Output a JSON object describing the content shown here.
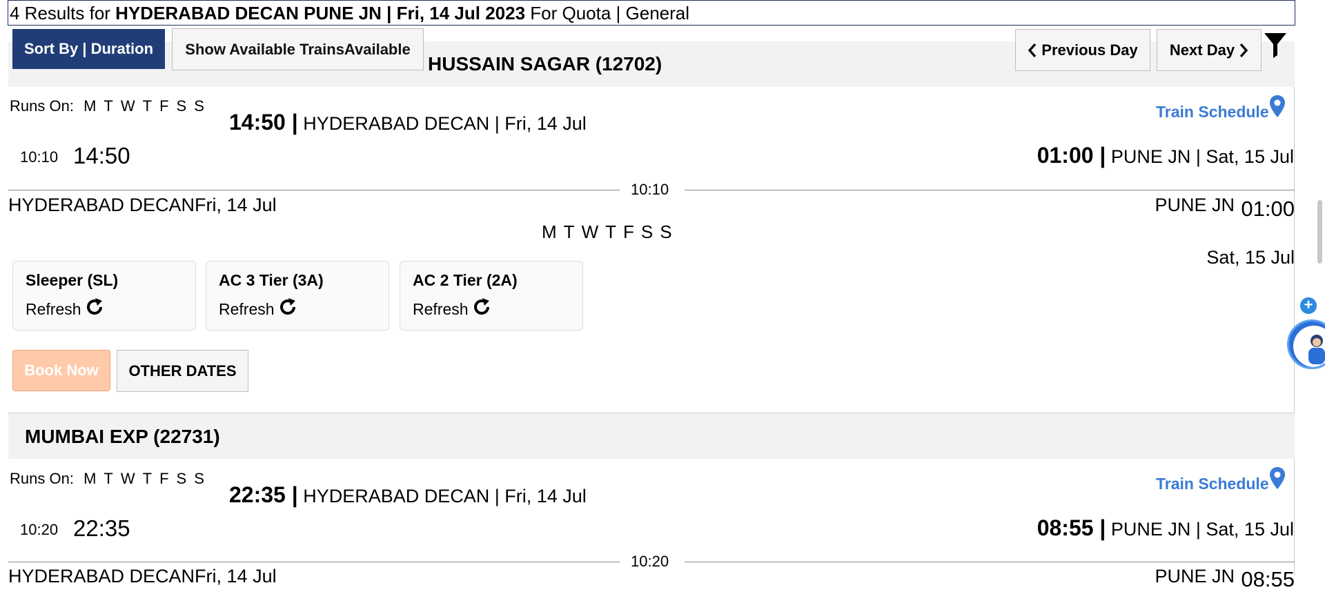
{
  "results": {
    "count_prefix": "4 Results for ",
    "route": "HYDERABAD DECAN PUNE JN | Fri, 14 Jul 2023",
    "quota_text": " For Quota | General"
  },
  "toolbar": {
    "sort_label": "Sort By | Duration",
    "show_available_label": "Show Available TrainsAvailable",
    "prev_day_label": "Previous Day",
    "next_day_label": "Next Day"
  },
  "trains": [
    {
      "name": "HUSSAIN SAGAR (12702)",
      "runs_on_label": "Runs On:",
      "days": [
        "M",
        "T",
        "W",
        "T",
        "F",
        "S",
        "S"
      ],
      "dep_time": "14:50 |",
      "dep_info": " HYDERABAD DECAN | Fri, 14 Jul",
      "duration_small": "10:10",
      "dep_time_big": "14:50",
      "arr_time": "01:00 |",
      "arr_info": " PUNE JN | Sat, 15 Jul",
      "schedule_label": "Train Schedule",
      "mid_duration": "10:10",
      "from_station": "HYDERABAD DECANFri, 14 Jul",
      "to_station": "PUNE JN",
      "arr_time_big": "01:00",
      "arr_date": "Sat, 15 Jul",
      "classes": [
        {
          "name": "Sleeper (SL)",
          "refresh": "Refresh"
        },
        {
          "name": "AC 3 Tier (3A)",
          "refresh": "Refresh"
        },
        {
          "name": "AC 2 Tier (2A)",
          "refresh": "Refresh"
        }
      ],
      "book_label": "Book Now",
      "other_dates_label": "OTHER DATES"
    },
    {
      "name": "MUMBAI EXP (22731)",
      "runs_on_label": "Runs On:",
      "days": [
        "M",
        "T",
        "W",
        "T",
        "F",
        "S",
        "S"
      ],
      "dep_time": "22:35 |",
      "dep_info": " HYDERABAD DECAN | Fri, 14 Jul",
      "duration_small": "10:20",
      "dep_time_big": "22:35",
      "arr_time": "08:55 |",
      "arr_info": " PUNE JN | Sat, 15 Jul",
      "schedule_label": "Train Schedule",
      "mid_duration": "10:20",
      "from_station": "HYDERABAD DECANFri, 14 Jul",
      "to_station": "PUNE JN",
      "arr_time_big": "08:55"
    }
  ],
  "icons": {
    "filter": "filter-icon",
    "pin": "map-pin-icon",
    "refresh": "refresh-icon",
    "plus": "plus-circle-icon"
  },
  "colors": {
    "primary": "#213d77",
    "link": "#3a7bd5",
    "book_disabled": "#ffcaaa"
  }
}
